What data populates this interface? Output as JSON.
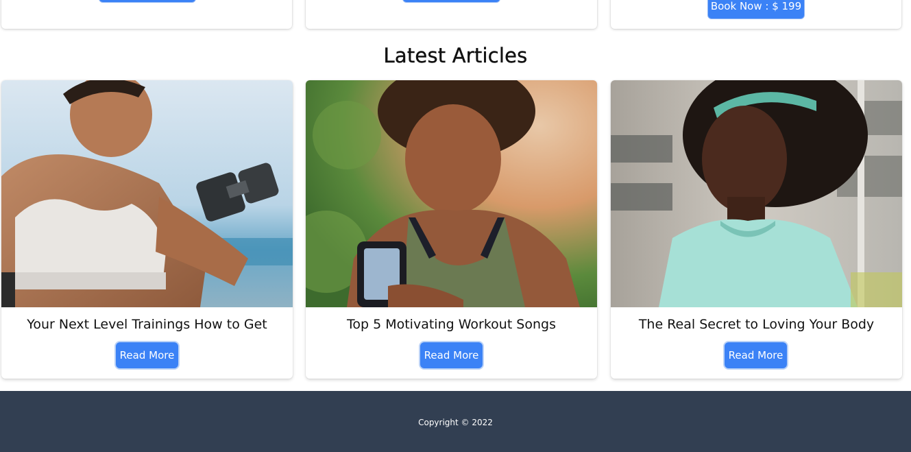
{
  "top_cards": {
    "third_button_label": "Book Now : $ 199"
  },
  "latest_articles": {
    "heading": "Latest Articles",
    "items": [
      {
        "title": "Your Next Level Trainings How to Get",
        "button_label": "Read More"
      },
      {
        "title": "Top 5 Motivating Workout Songs",
        "button_label": "Read More"
      },
      {
        "title": "The Real Secret to Loving Your Body",
        "button_label": "Read More"
      }
    ]
  },
  "colors": {
    "accent": "#3b82f6",
    "footer_bg": "#323f52"
  },
  "footer": {
    "copyright": "Copyright © 2022"
  }
}
